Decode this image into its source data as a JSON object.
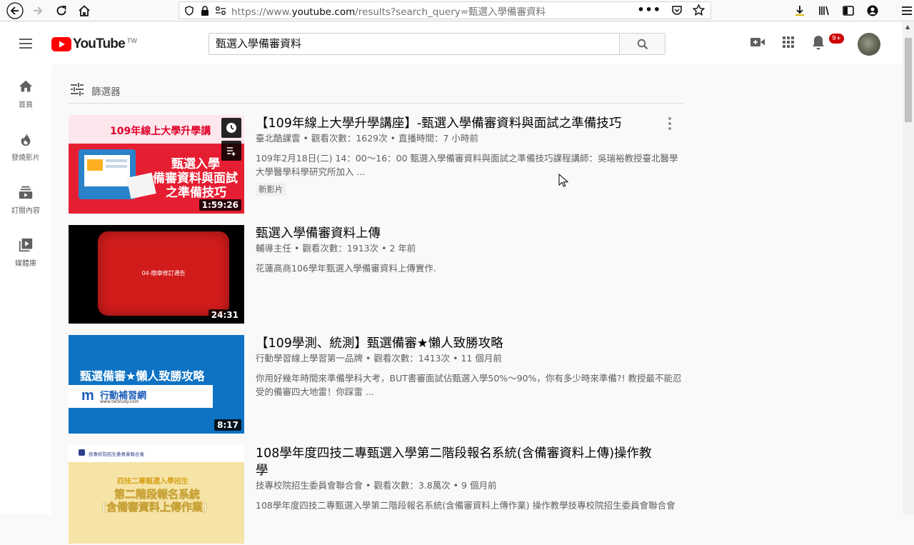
{
  "browser": {
    "url_scheme": "https://www.",
    "url_host": "youtube.com",
    "url_path": "/results?search_query=甄選入學備審資料"
  },
  "header": {
    "logo_text": "YouTube",
    "region": "TW",
    "search_value": "甄選入學備審資料",
    "notification_count": "9+"
  },
  "guide": {
    "items": [
      {
        "label": "首頁",
        "icon": "home-icon"
      },
      {
        "label": "發燒影片",
        "icon": "fire-icon"
      },
      {
        "label": "訂閱內容",
        "icon": "subscriptions-icon"
      },
      {
        "label": "媒體庫",
        "icon": "library-icon"
      }
    ]
  },
  "filter": {
    "label": "篩選器"
  },
  "results": [
    {
      "title": "【109年線上大學升學講座】-甄選入學備審資料與面試之準備技巧",
      "meta": "臺北酷課雲 • 觀看次數：1629次 • 直播時間：7 小時前",
      "desc": "109年2月18日(二) 14：00〜16：00 甄選入學備審資料與面試之準備技巧課程講師：吳瑞裕教授臺北醫學大學醫學科學研究所加入 ...",
      "tag": "新影片",
      "duration": "1:59:26",
      "thumb_texts": [
        "109年線上大學升學講",
        "甄選入學",
        "備審資料與面試",
        "之準備技巧"
      ]
    },
    {
      "title": "甄選入學備審資料上傳",
      "meta": "輔導主任 • 觀看次數：1913次 • 2 年前",
      "desc": "花蓮高商106學年甄選入學備審資料上傳實作.",
      "duration": "24:31",
      "thumb_texts": [
        "04-簡章修訂通告"
      ]
    },
    {
      "title": "【109學測、統測】甄選備審★懶人致勝攻略",
      "meta": "行動學習線上學習第一品牌 • 觀看次數：1413次 • 11 個月前",
      "desc": "你用好幾年時間來準備學科大考，BUT書審面試佔甄選入學50%〜90%，你有多少時來準備?! 教授最不能忍受的備審四大地雷！你踩雷 ...",
      "duration": "8:17",
      "thumb_texts": [
        "甄選備審★懶人致勝攻略",
        "行動補習網",
        "www.twStudy.com"
      ]
    },
    {
      "title": "108學年度四技二專甄選入學第二階段報名系統(含備審資料上傳)操作教學",
      "meta": "技專校院招生委員會聯合會 • 觀看次數：3.8萬次 • 9 個月前",
      "desc": "108學年度四技二專甄選入學第二階段報名系統(含備審資料上傳作業) 操作教學技專校院招生委員會聯合會",
      "thumb_texts": [
        "技專校院招生委員會聯合會",
        "四技二專甄選入學招生",
        "第二階段報名系統",
        "(含備審資料上傳作業)"
      ]
    }
  ]
}
